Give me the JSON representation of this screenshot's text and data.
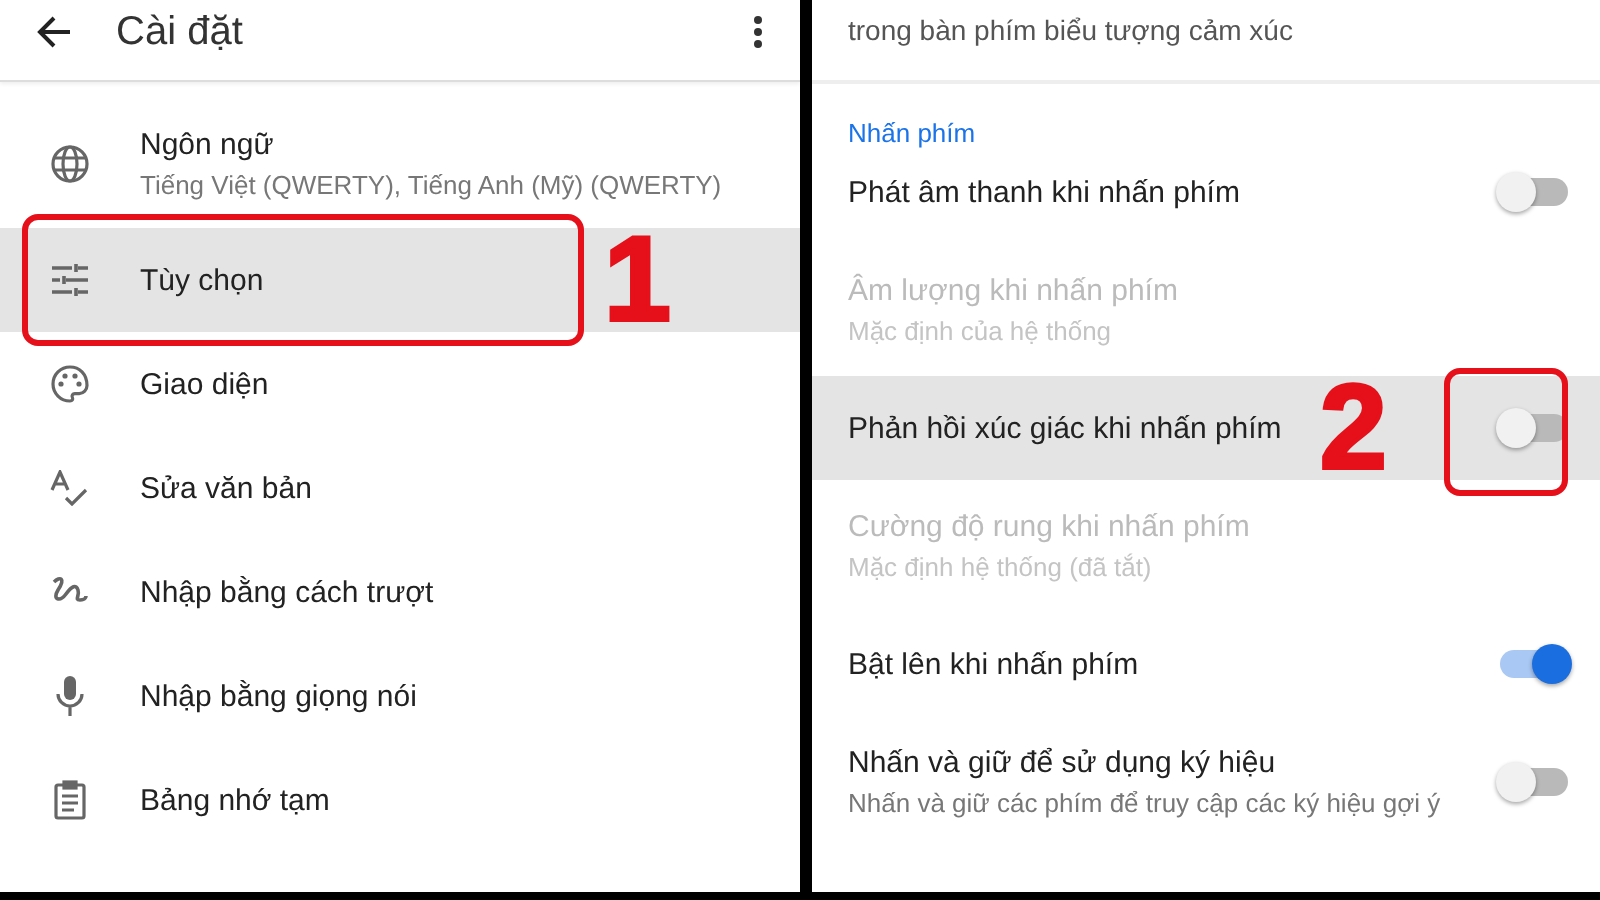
{
  "left_panel": {
    "header": {
      "title": "Cài đặt"
    },
    "items": [
      {
        "title": "Ngôn ngữ",
        "subtitle": "Tiếng Việt (QWERTY), Tiếng Anh (Mỹ) (QWERTY)",
        "selected": false
      },
      {
        "title": "Tùy chọn",
        "selected": true
      },
      {
        "title": "Giao diện",
        "selected": false
      },
      {
        "title": "Sửa văn bản",
        "selected": false
      },
      {
        "title": "Nhập bằng cách trượt",
        "selected": false
      },
      {
        "title": "Nhập bằng giọng nói",
        "selected": false
      },
      {
        "title": "Bảng nhớ tạm",
        "selected": false
      }
    ],
    "annotation": {
      "number": "1"
    }
  },
  "right_panel": {
    "top_item": {
      "subtitle": "trong bàn phím biểu tượng cảm xúc"
    },
    "section": "Nhấn phím",
    "items": [
      {
        "kind": "toggle",
        "title": "Phát âm thanh khi nhấn phím",
        "on": false,
        "selected": false,
        "disabled": false
      },
      {
        "kind": "plain",
        "title": "Âm lượng khi nhấn phím",
        "subtitle": "Mặc định của hệ thống",
        "selected": false,
        "disabled": true
      },
      {
        "kind": "toggle",
        "title": "Phản hồi xúc giác khi nhấn phím",
        "on": false,
        "selected": true,
        "disabled": false
      },
      {
        "kind": "plain",
        "title": "Cường độ rung khi nhấn phím",
        "subtitle": "Mặc định hệ thống (đã tắt)",
        "selected": false,
        "disabled": true
      },
      {
        "kind": "toggle",
        "title": "Bật lên khi nhấn phím",
        "on": true,
        "selected": false,
        "disabled": false
      },
      {
        "kind": "toggle",
        "title": "Nhấn và giữ để sử dụng ký hiệu",
        "subtitle": "Nhấn và giữ các phím để truy cập các ký hiệu gợi ý",
        "on": false,
        "selected": false,
        "disabled": false
      }
    ],
    "annotation": {
      "number": "2"
    }
  }
}
